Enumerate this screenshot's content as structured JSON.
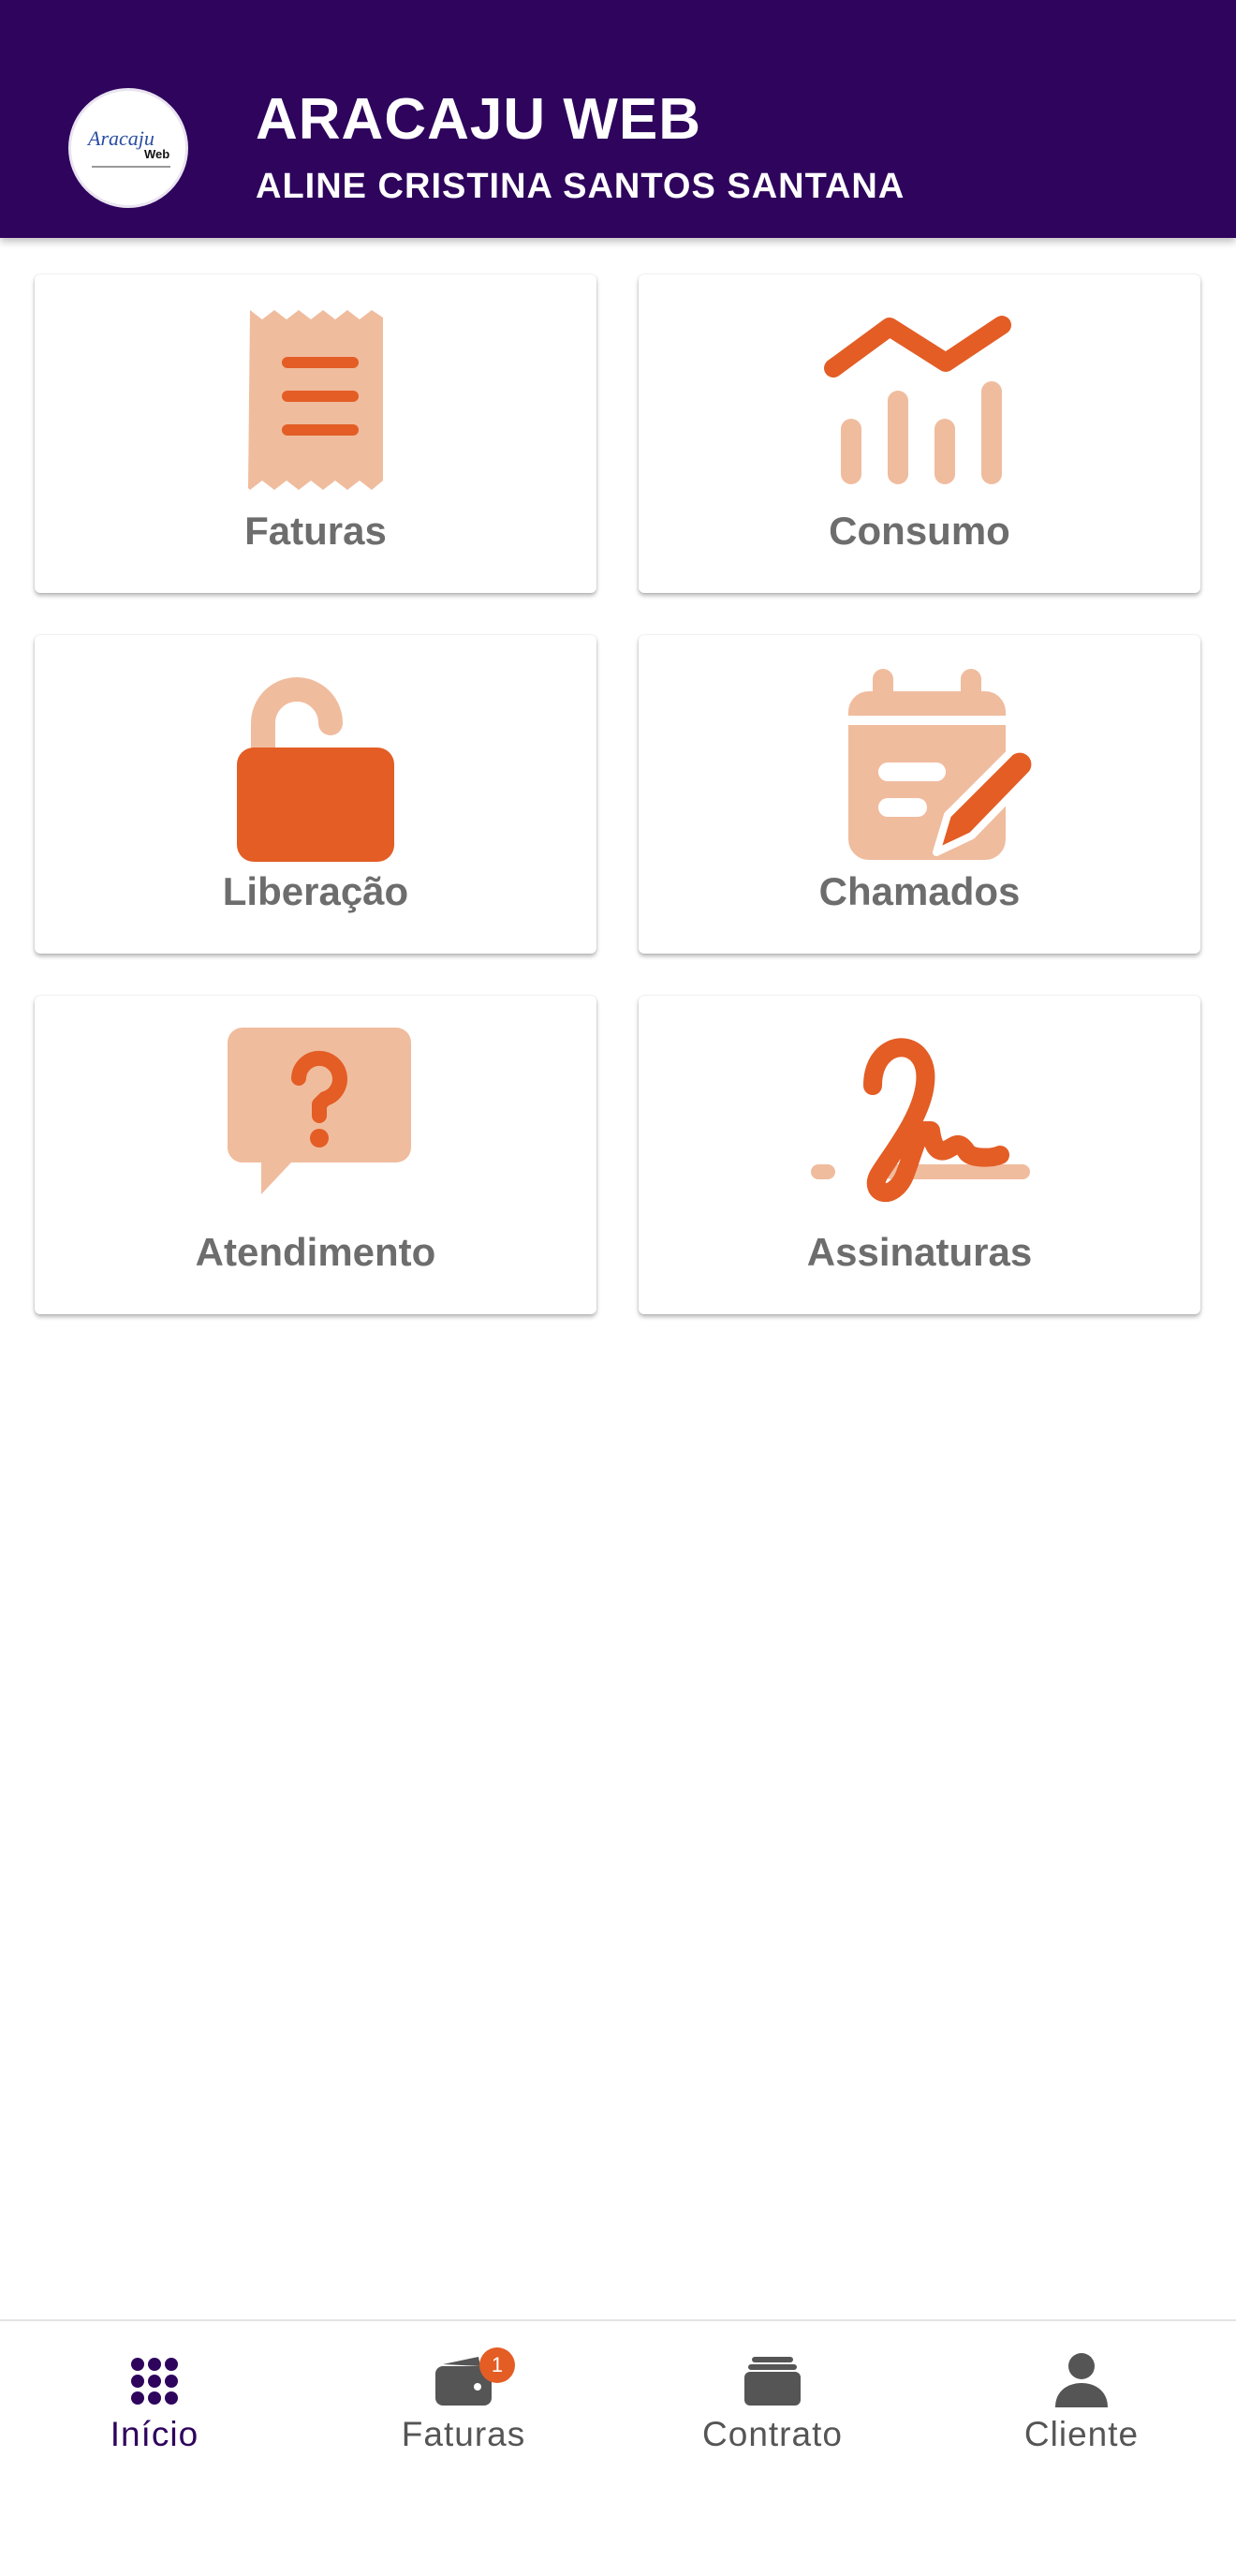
{
  "header": {
    "app_title": "ARACAJU WEB",
    "user_name": "ALINE CRISTINA SANTOS SANTANA",
    "logo": {
      "line1": "Aracaju",
      "line2": "Web"
    },
    "background_color": "#2e045d"
  },
  "colors": {
    "icon_dark": "#e35d25",
    "icon_light": "#f0bc9e",
    "label": "#6d6d6d"
  },
  "menu": {
    "cards": [
      {
        "label": "Faturas",
        "icon": "receipt-icon"
      },
      {
        "label": "Consumo",
        "icon": "chart-trend-icon"
      },
      {
        "label": "Liberação",
        "icon": "unlock-icon"
      },
      {
        "label": "Chamados",
        "icon": "calendar-edit-icon"
      },
      {
        "label": "Atendimento",
        "icon": "help-chat-icon"
      },
      {
        "label": "Assinaturas",
        "icon": "signature-icon"
      }
    ]
  },
  "bottom_nav": {
    "items": [
      {
        "label": "Início",
        "icon": "grid-dots-icon",
        "active": true
      },
      {
        "label": "Faturas",
        "icon": "wallet-icon",
        "badge": "1"
      },
      {
        "label": "Contrato",
        "icon": "folder-stack-icon"
      },
      {
        "label": "Cliente",
        "icon": "person-icon"
      }
    ]
  }
}
